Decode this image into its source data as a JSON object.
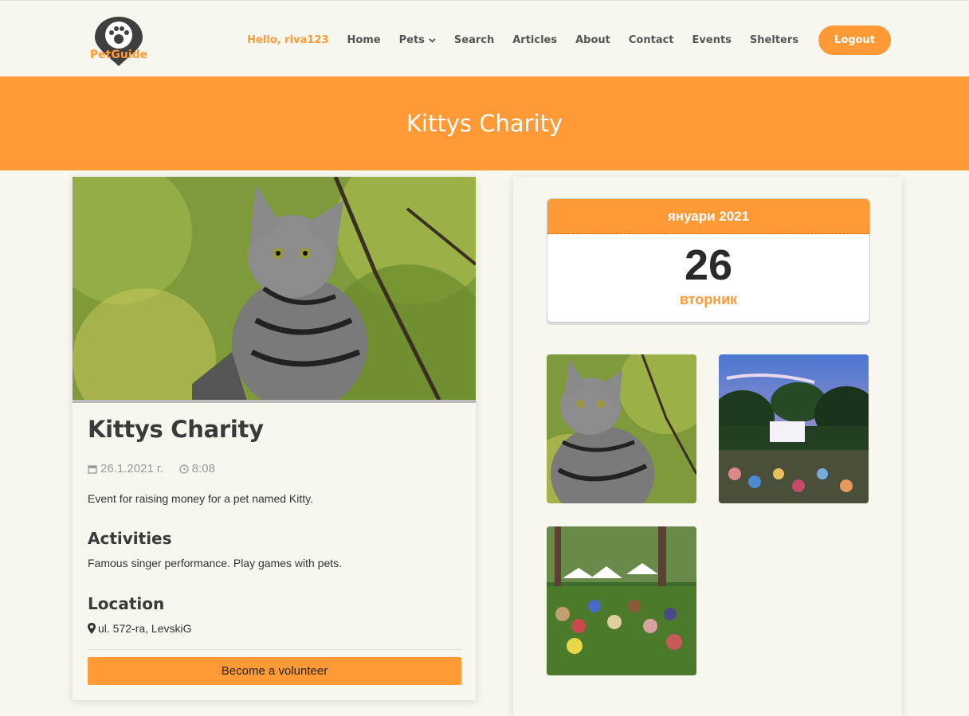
{
  "brand": {
    "logo_text": "PetGuide"
  },
  "nav": {
    "greeting": "Hello, riva123",
    "items": [
      "Home",
      "Pets",
      "Search",
      "Articles",
      "About",
      "Contact",
      "Events",
      "Shelters"
    ],
    "logout": "Logout"
  },
  "banner": {
    "title": "Kittys Charity"
  },
  "event": {
    "title": "Kittys Charity",
    "date": "26.1.2021 г.",
    "time": "8:08",
    "description": "Event for raising money for a pet named Kitty.",
    "activities_heading": "Activities",
    "activities": "Famous singer performance. Play games with pets.",
    "location_heading": "Location",
    "location": "ul. 572-ra, LevskiG",
    "volunteer_button": "Become a volunteer"
  },
  "calendar": {
    "month": "януари 2021",
    "day": "26",
    "weekday": "вторник"
  },
  "colors": {
    "accent": "#ff9a36",
    "background": "#f7f6ef"
  }
}
